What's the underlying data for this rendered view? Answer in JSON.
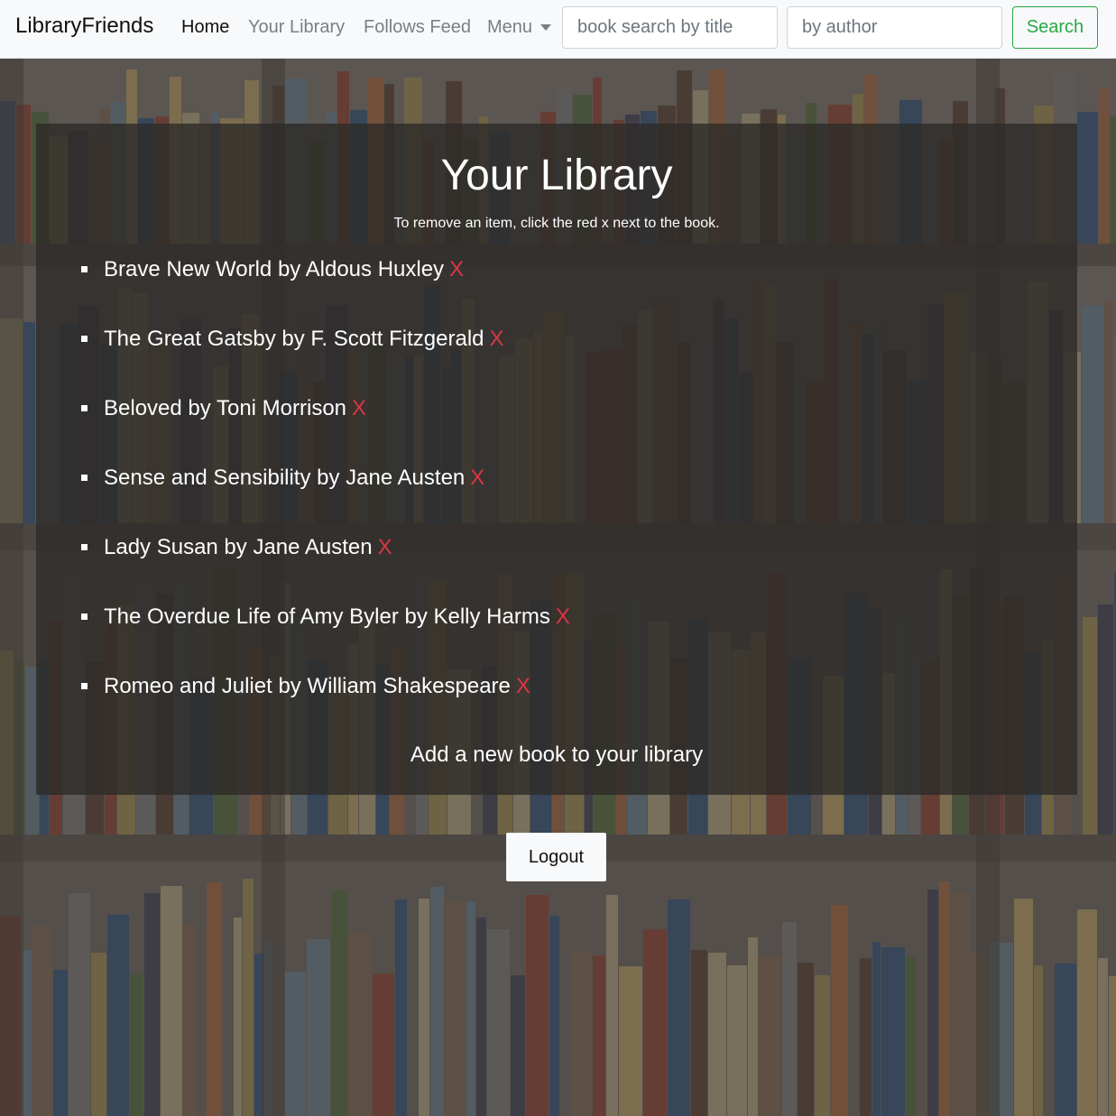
{
  "navbar": {
    "brand": "LibraryFriends",
    "links": [
      {
        "label": "Home",
        "active": true
      },
      {
        "label": "Your Library",
        "active": false
      },
      {
        "label": "Follows Feed",
        "active": false
      }
    ],
    "menu_label": "Menu",
    "title_search_placeholder": "book search by title",
    "author_search_placeholder": "by author",
    "search_button_label": "Search",
    "search_color": "#28a745"
  },
  "main": {
    "title": "Your Library",
    "instructions": "To remove an item, click the red x next to the book.",
    "books": [
      {
        "text": "Brave New World by Aldous Huxley",
        "remove_label": "X"
      },
      {
        "text": "The Great Gatsby by F. Scott Fitzgerald",
        "remove_label": "X"
      },
      {
        "text": "Beloved by Toni Morrison",
        "remove_label": "X"
      },
      {
        "text": "Sense and Sensibility by Jane Austen",
        "remove_label": "X"
      },
      {
        "text": "Lady Susan by Jane Austen",
        "remove_label": "X"
      },
      {
        "text": "The Overdue Life of Amy Byler by Kelly Harms",
        "remove_label": "X"
      },
      {
        "text": "Romeo and Juliet by William Shakespeare",
        "remove_label": "X"
      }
    ],
    "add_book_label": "Add a new book to your library",
    "remove_color": "#dc3545"
  },
  "logout_label": "Logout"
}
